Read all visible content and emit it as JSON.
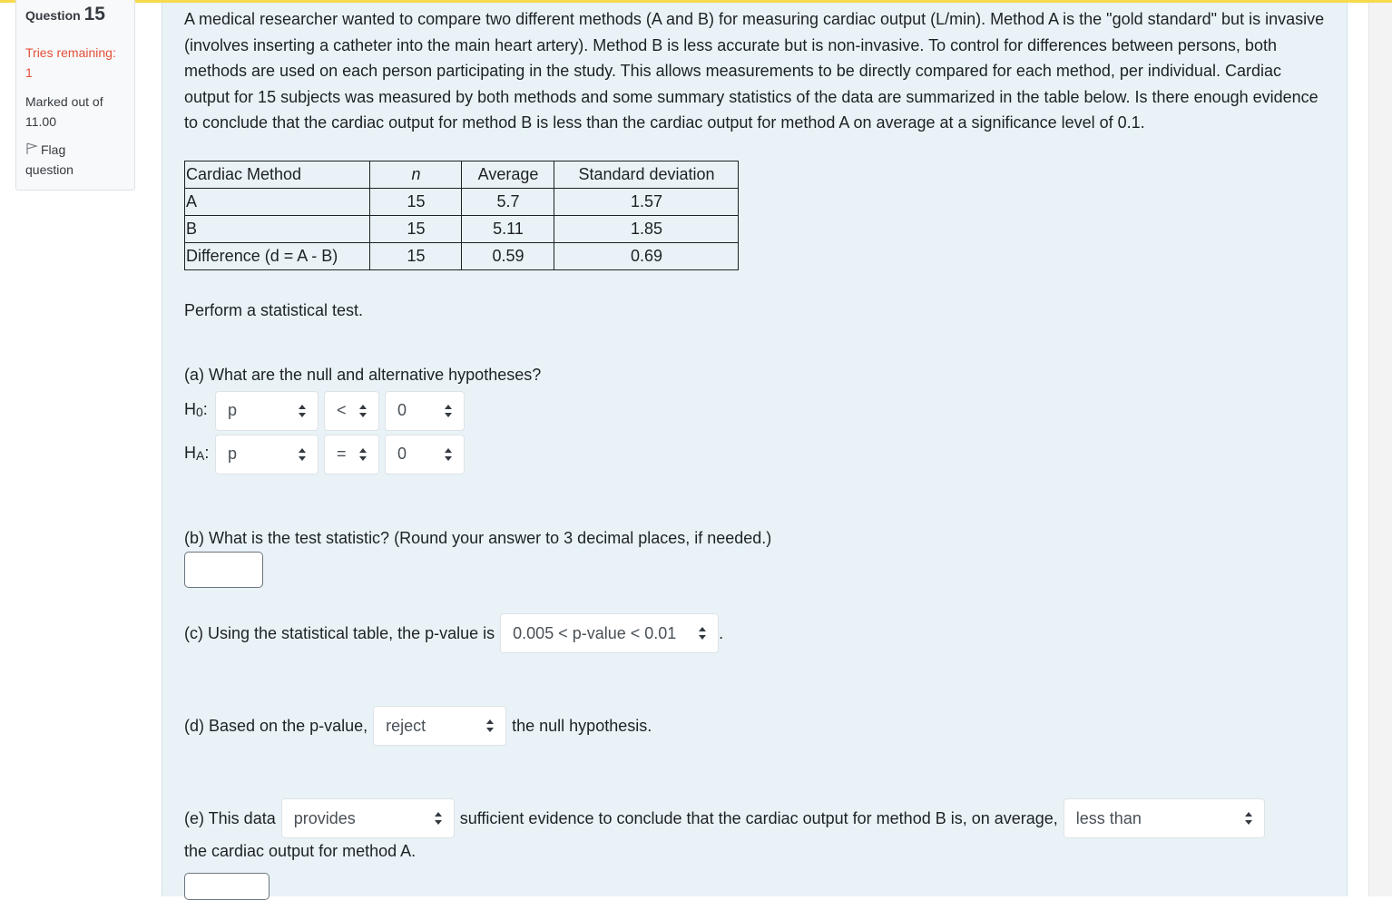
{
  "info": {
    "question_prefix": "Question",
    "question_number": "15",
    "tries_label": "Tries remaining:",
    "tries_value": "1",
    "marked_label": "Marked out of",
    "marked_value": "11.00",
    "flag_label": "Flag",
    "flag_label2": "question"
  },
  "question": {
    "intro": "A medical researcher wanted to compare two different methods (A and B) for measuring cardiac output (L/min). Method A is the \"gold standard\" but is invasive (involves inserting a catheter into the main heart artery). Method B is less accurate but is non-invasive. To control for differences between persons, both methods are used on each person participating in the study. This allows measurements to be directly compared for each method, per individual. Cardiac output for 15 subjects was measured by both methods and some summary statistics of the data are summarized in the table below. Is there enough evidence to conclude that the cardiac output for method B is less than the cardiac output for method A on average at a significance level of 0.1.",
    "table": {
      "headers": [
        "Cardiac Method",
        "n",
        "Average",
        "Standard deviation"
      ],
      "rows": [
        [
          "A",
          "15",
          "5.7",
          "1.57"
        ],
        [
          "B",
          "15",
          "5.11",
          "1.85"
        ],
        [
          "Difference (d = A - B)",
          "15",
          "0.59",
          "0.69"
        ]
      ]
    },
    "perform": "Perform a statistical test.",
    "part_a": {
      "prompt": "(a) What are the null and alternative hypotheses?",
      "h0": {
        "label": "H",
        "sub": "0",
        "param": "p",
        "op": "<",
        "value": "0"
      },
      "ha": {
        "label": "H",
        "sub": "A",
        "param": "p",
        "op": "=",
        "value": "0"
      }
    },
    "part_b": {
      "prompt": "(b) What is the test statistic? (Round your answer to 3 decimal places, if needed.)",
      "answer": ""
    },
    "part_c": {
      "prompt": "(c) Using the statistical table, the p-value is",
      "selected": "0.005 < p-value < 0.01",
      "suffix": "."
    },
    "part_d": {
      "prompt": "(d) Based on the p-value,",
      "selected": "reject",
      "suffix": "the null hypothesis."
    },
    "part_e": {
      "prompt": "(e) This data",
      "selected1": "provides",
      "middle": "sufficient evidence to conclude that the cardiac output for method B is, on average,",
      "selected2": "less than",
      "suffix": "the cardiac output for method A."
    }
  }
}
